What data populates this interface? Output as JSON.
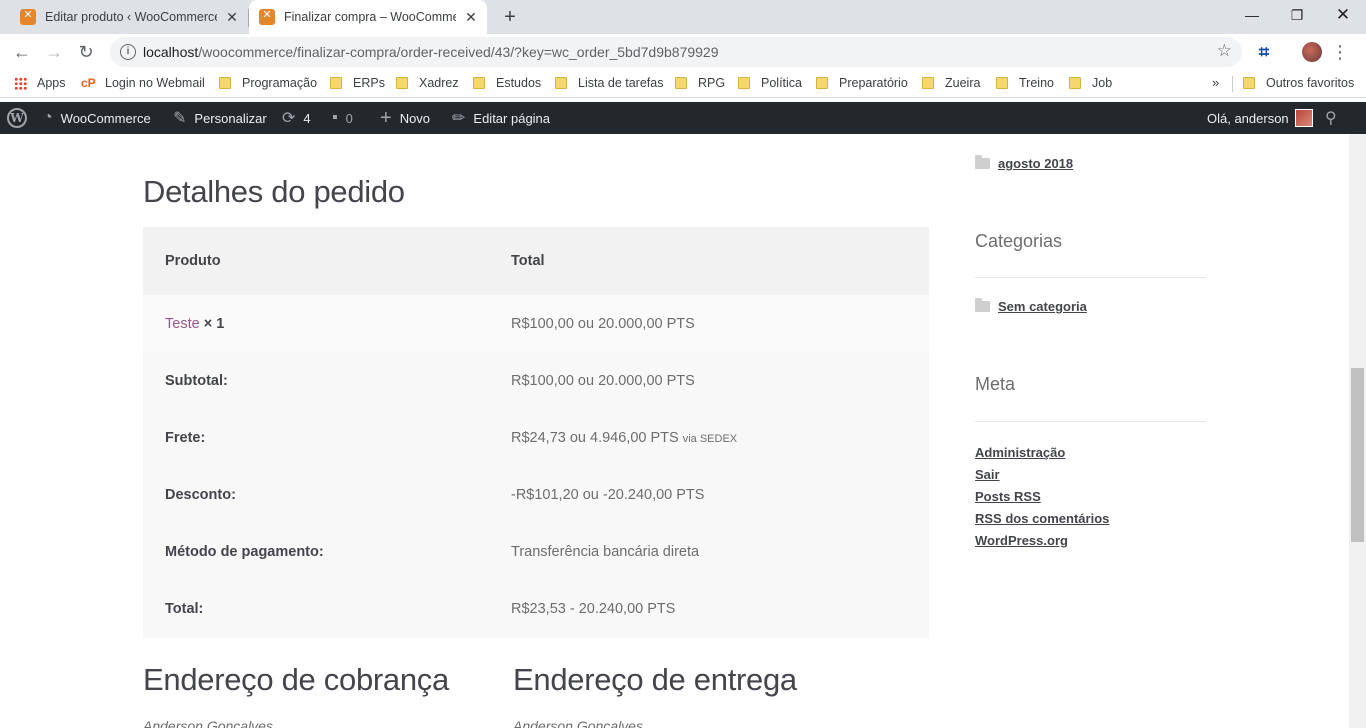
{
  "browser": {
    "tabs": [
      {
        "title": "Editar produto ‹ WooCommerce — WordPress",
        "active": false
      },
      {
        "title": "Finalizar compra – WooCommerce",
        "active": true
      }
    ],
    "new_tab_label": "+",
    "window_controls": {
      "minimize": "—",
      "restore": "❐",
      "close": "✕"
    },
    "nav": {
      "back": "←",
      "forward": "→",
      "reload": "↻"
    },
    "url": {
      "host": "localhost",
      "path": "/woocommerce/finalizar-compra/order-received/43/?key=wc_order_5bd7d9b879929"
    },
    "bookmarks": {
      "apps": "Apps",
      "webmail": "Login no Webmail",
      "folders": [
        "Programação",
        "ERPs",
        "Xadrez",
        "Estudos",
        "Lista de tarefas",
        "RPG",
        "Política",
        "Preparatório",
        "Zueira",
        "Treino",
        "Job"
      ],
      "more": "»",
      "other": "Outros favoritos"
    }
  },
  "adminbar": {
    "site": "WooCommerce",
    "customize": "Personalizar",
    "updates_count": "4",
    "comments_count": "0",
    "new": "Novo",
    "edit_page": "Editar página",
    "greeting": "Olá, anderson"
  },
  "order": {
    "heading": "Detalhes do pedido",
    "columns": {
      "product": "Produto",
      "total": "Total"
    },
    "item": {
      "name": "Teste",
      "qty": "× 1",
      "total": "R$100,00 ou 20.000,00 PTS"
    },
    "totals": [
      {
        "label": "Subtotal:",
        "value": "R$100,00 ou 20.000,00 PTS",
        "note": ""
      },
      {
        "label": "Frete:",
        "value": "R$24,73 ou 4.946,00 PTS",
        "note": "via SEDEX"
      },
      {
        "label": "Desconto:",
        "value": "-R$101,20 ou -20.240,00 PTS",
        "note": ""
      },
      {
        "label": "Método de pagamento:",
        "value": "Transferência bancária direta",
        "note": ""
      },
      {
        "label": "Total:",
        "value": "R$23,53 - 20.240,00 PTS",
        "note": ""
      }
    ],
    "billing_heading": "Endereço de cobrança",
    "shipping_heading": "Endereço de entrega",
    "billing_name": "Anderson Gonçalves",
    "shipping_name": "Anderson Gonçalves"
  },
  "sidebar": {
    "archive": "agosto 2018",
    "categories_title": "Categorias",
    "category": "Sem categoria",
    "meta_title": "Meta",
    "meta_links": [
      "Administração",
      "Sair",
      "Posts RSS",
      "RSS dos comentários",
      "WordPress.org"
    ]
  },
  "colors": {
    "link": "#96588a",
    "adminbar": "#23282d",
    "text": "#43454b"
  }
}
